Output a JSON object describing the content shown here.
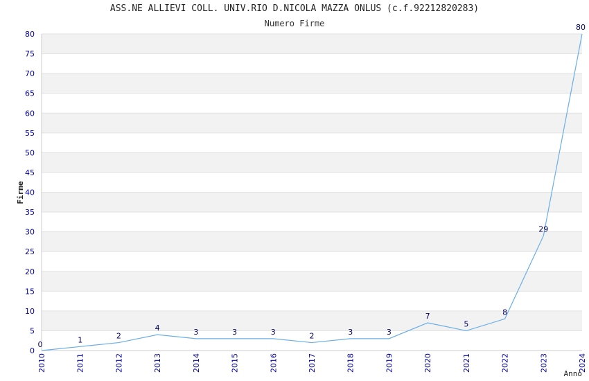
{
  "chart_data": {
    "type": "line",
    "title": "ASS.NE ALLIEVI COLL. UNIV.RIO D.NICOLA MAZZA ONLUS (c.f.92212820283)",
    "subtitle": "Numero Firme",
    "xlabel": "Anno",
    "ylabel": "Firme",
    "categories": [
      "2010",
      "2011",
      "2012",
      "2013",
      "2014",
      "2015",
      "2016",
      "2017",
      "2018",
      "2019",
      "2020",
      "2021",
      "2022",
      "2023",
      "2024"
    ],
    "series": [
      {
        "values": [
          0,
          1,
          2,
          4,
          3,
          3,
          3,
          2,
          3,
          3,
          7,
          5,
          8,
          29,
          80
        ]
      }
    ],
    "ylim": [
      0,
      80
    ],
    "yticks": [
      0,
      5,
      10,
      15,
      20,
      25,
      30,
      35,
      40,
      45,
      50,
      55,
      60,
      65,
      70,
      75,
      80
    ],
    "grid": true,
    "line_color": "#6aaee8",
    "band_color": "#f2f2f2",
    "tick_color": "#0000aa"
  }
}
